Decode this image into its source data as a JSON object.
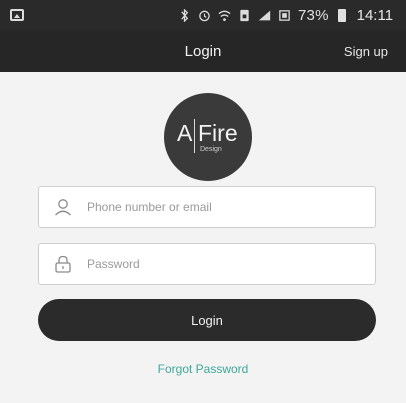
{
  "status_bar": {
    "battery_percent": "73%",
    "time": "14:11"
  },
  "nav": {
    "title": "Login",
    "signup_label": "Sign up"
  },
  "logo": {
    "letter": "A",
    "word": "Fire",
    "sub": "Design"
  },
  "form": {
    "phone_placeholder": "Phone number or email",
    "password_placeholder": "Password",
    "login_label": "Login",
    "forgot_label": "Forgot Password"
  },
  "colors": {
    "bar_bg": "#262626",
    "button_bg": "#2b2b2b",
    "link": "#3fa79a"
  }
}
